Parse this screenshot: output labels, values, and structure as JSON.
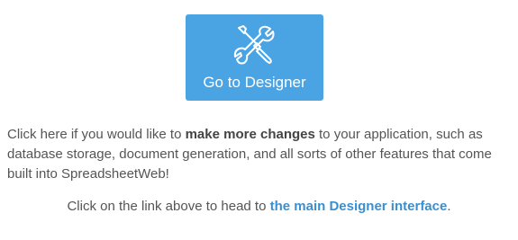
{
  "button": {
    "label": "Go to Designer",
    "icon": "wrench-screwdriver-icon",
    "color": "#4aa4e4"
  },
  "description": {
    "part1": "Click here if you would like to ",
    "bold": "make more changes",
    "part2": " to your application, such as database storage, document generation, and all sorts of other features that come built into SpreadsheetWeb!"
  },
  "link_line": {
    "prefix": "Click on the link above to head to ",
    "link_text": "the main Designer interface",
    "suffix": ".",
    "link_color": "#3a8fd1"
  }
}
